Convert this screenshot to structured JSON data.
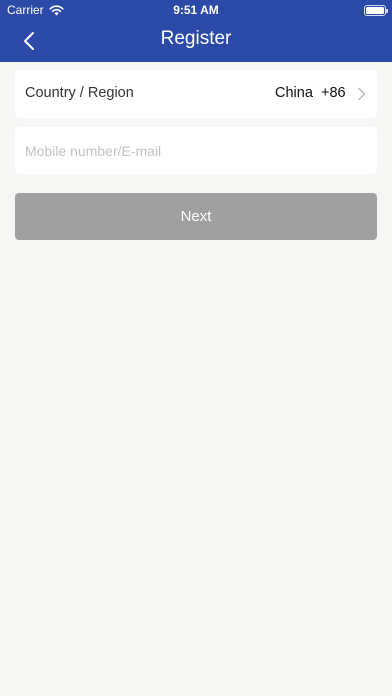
{
  "status_bar": {
    "carrier": "Carrier",
    "time": "9:51 AM",
    "wifi_icon": "wifi-icon",
    "battery_icon": "battery-icon"
  },
  "nav": {
    "title": "Register",
    "back_icon": "chevron-left-icon"
  },
  "form": {
    "country_label": "Country / Region",
    "country_value": "China",
    "country_code": "+86",
    "country_chevron_icon": "chevron-right-icon",
    "account_placeholder": "Mobile number/E-mail",
    "account_value": "",
    "next_label": "Next"
  },
  "colors": {
    "header": "#2c4aa8",
    "background": "#f6f6f4",
    "button_disabled": "#a0a0a0"
  }
}
